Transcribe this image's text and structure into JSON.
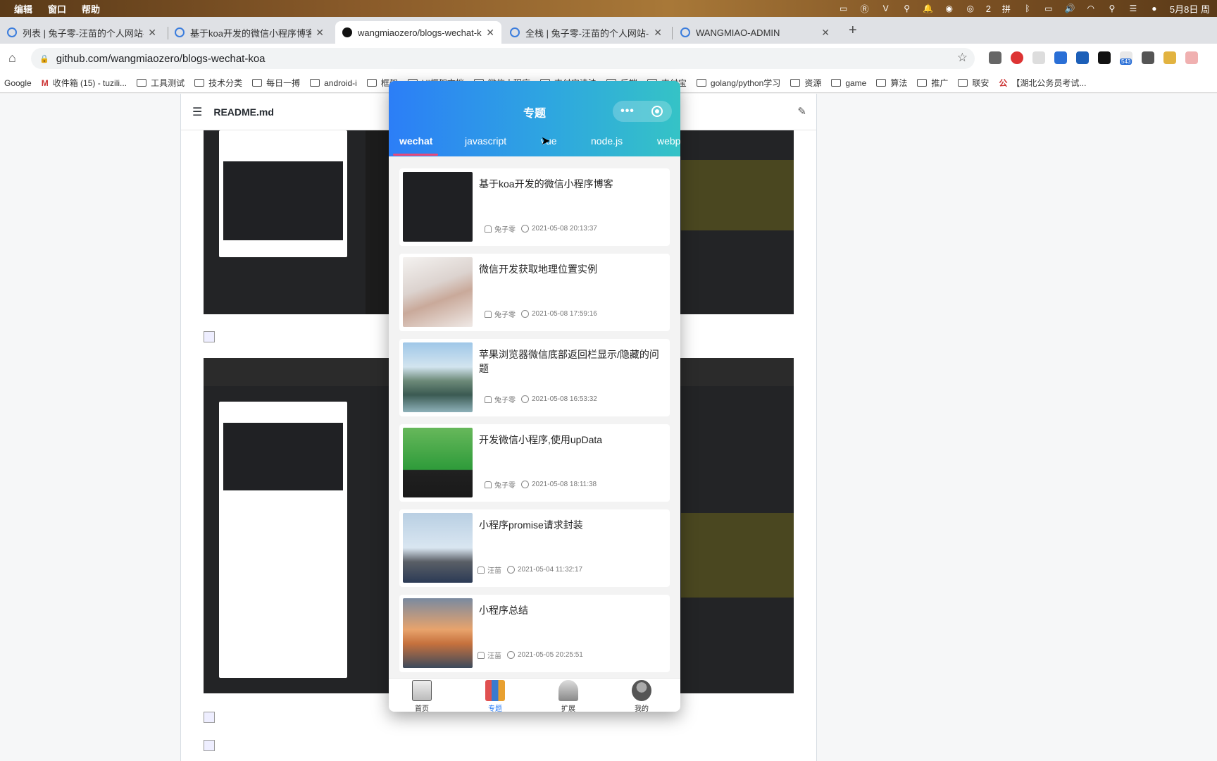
{
  "menubar": {
    "items": [
      "编辑",
      "窗口",
      "帮助"
    ],
    "wechat_count": "2",
    "date": "5月8日 周"
  },
  "tabs": [
    {
      "title": "列表 | 兔子零-汪苗的个人网站-全",
      "active": false
    },
    {
      "title": "基于koa开发的微信小程序博客",
      "active": false
    },
    {
      "title": "wangmiaozero/blogs-wechat-k",
      "active": true
    },
    {
      "title": "全栈 | 兔子零-汪苗的个人网站-全",
      "active": false
    },
    {
      "title": "WANGMIAO-ADMIN",
      "active": false
    }
  ],
  "address": {
    "url": "github.com/wangmiaozero/blogs-wechat-koa"
  },
  "extension_badge": "543",
  "bookmarks": [
    "Google",
    "收件箱 (15) - tuzili...",
    "工具测试",
    "技术分类",
    "每日一搏",
    "android-i",
    "框架",
    "UI框架文档",
    "微信小程序",
    "支付宝读法",
    "后端",
    "支付宝",
    "golang/python学习",
    "资源",
    "game",
    "算法",
    "推广",
    "联安",
    "【湖北公务员考试..."
  ],
  "readme": {
    "filename": "README.md"
  },
  "miniprogram": {
    "title": "专题",
    "tabs": [
      "wechat",
      "javascript",
      "vue",
      "node.js",
      "webpack"
    ],
    "active_tab": "wechat",
    "articles": [
      {
        "title": "基于koa开发的微信小程序博客",
        "author": "兔子零",
        "time": "2021-05-08 20:13:37",
        "thumb": "code-screenshot"
      },
      {
        "title": "微信开发获取地理位置实例",
        "author": "兔子零",
        "time": "2021-05-08 17:59:16",
        "thumb": "girl-photo"
      },
      {
        "title": "苹果浏览器微信底部返回栏显示/隐藏的问题",
        "author": "兔子零",
        "time": "2021-05-08 16:53:32",
        "thumb": "lake-photo"
      },
      {
        "title": "开发微信小程序,使用upData",
        "author": "兔子零",
        "time": "2021-05-08 18:11:38",
        "thumb": "wechat-logo"
      },
      {
        "title": "小程序promise请求封装",
        "author": "汪苗",
        "time": "2021-05-04 11:32:17",
        "thumb": "tree-photo"
      },
      {
        "title": "小程序总结",
        "author": "汪苗",
        "time": "2021-05-05 20:25:51",
        "thumb": "sunset-photo"
      }
    ],
    "tabbar": [
      {
        "label": "首页",
        "icon": "home-icon",
        "active": false
      },
      {
        "label": "专题",
        "icon": "topics-icon",
        "active": true
      },
      {
        "label": "扩展",
        "icon": "extend-icon",
        "active": false
      },
      {
        "label": "我的",
        "icon": "profile-icon",
        "active": false
      }
    ]
  },
  "colors": {
    "header_start": "#2c7ef7",
    "header_end": "#35c3c6",
    "active_underline": "#e64a7a",
    "tab_active": "#2c7ef7"
  }
}
